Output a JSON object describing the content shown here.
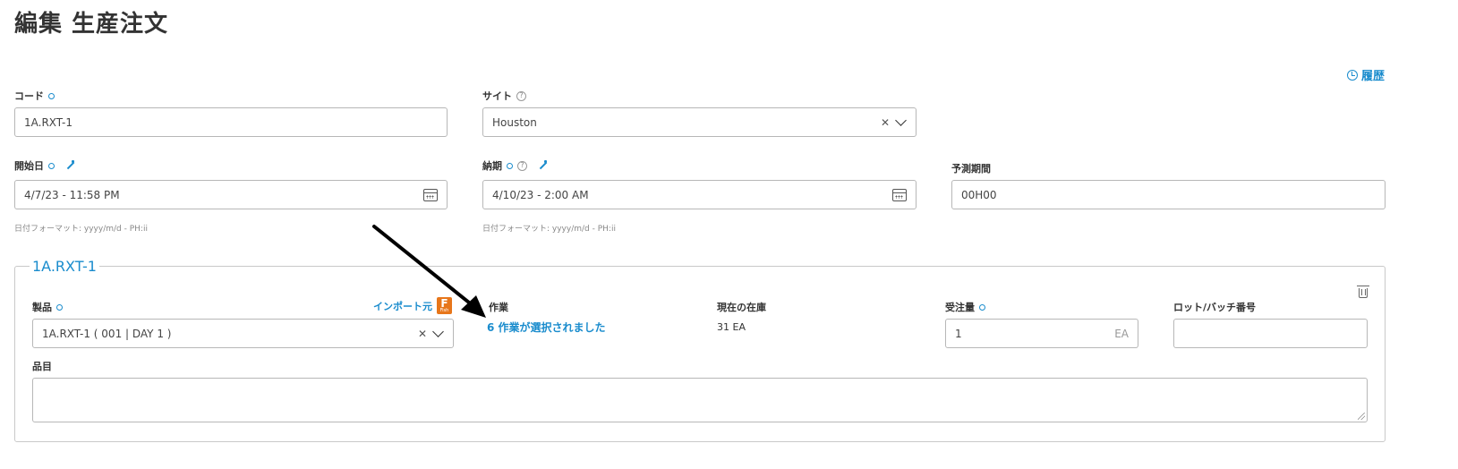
{
  "page_title": "編集 生産注文",
  "history_link": "履歴",
  "fields": {
    "code": {
      "label": "コード",
      "value": "1A.RXT-1"
    },
    "site": {
      "label": "サイト",
      "value": "Houston"
    },
    "start_date": {
      "label": "開始日",
      "value": "4/7/23 - 11:58 PM",
      "hint": "日付フォーマット: yyyy/m/d - PH:ii"
    },
    "due_date": {
      "label": "納期",
      "value": "4/10/23 - 2:00 AM",
      "hint": "日付フォーマット: yyyy/m/d - PH:ii"
    },
    "forecast_period": {
      "label": "予測期間",
      "value": "00H00"
    }
  },
  "line_item": {
    "legend": "1A.RXT-1",
    "product": {
      "label": "製品",
      "value": "1A.RXT-1 ( 001 | DAY 1 )",
      "import_label": "インポート元",
      "import_icon_letter": "F",
      "import_icon_sub": "Fish"
    },
    "operations": {
      "label": "作業",
      "link": "6 作業が選択されました"
    },
    "current_stock": {
      "label": "現在の在庫",
      "value": "31 EA"
    },
    "order_qty": {
      "label": "受注量",
      "value": "1",
      "unit": "EA"
    },
    "lot_batch": {
      "label": "ロット/バッチ番号",
      "value": ""
    },
    "item": {
      "label": "品目",
      "value": ""
    }
  },
  "colors": {
    "accent": "#1a8ccd",
    "import_icon": "#e7761a"
  },
  "icons": [
    "history-icon",
    "help-icon",
    "wand-icon",
    "calendar-icon",
    "clear-icon",
    "chevron-down-icon",
    "trash-icon",
    "fishbowl-icon",
    "arrow-annotation"
  ]
}
